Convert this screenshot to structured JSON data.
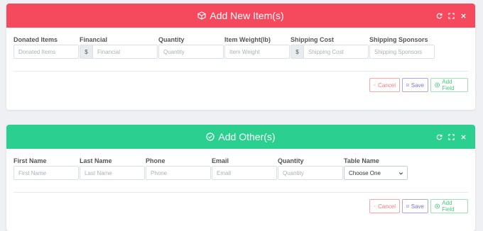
{
  "panel_items": {
    "title": "Add New Item(s)",
    "header_color": "#f5495e",
    "header_icon": "box-icon",
    "tools": [
      "refresh-icon",
      "expand-icon",
      "close-icon"
    ],
    "fields": [
      {
        "label": "Donated Items",
        "placeholder": "Donated Items"
      },
      {
        "label": "Financial",
        "addon": "$",
        "placeholder": "Financial"
      },
      {
        "label": "Quantity",
        "placeholder": "Quantity"
      },
      {
        "label": "Item Weight(lb)",
        "placeholder": "Item Weight"
      },
      {
        "label": "Shipping Cost",
        "addon": "$",
        "placeholder": "Shipping Cost"
      },
      {
        "label": "Shipping Sponsors",
        "placeholder": "Shipping Sponsors"
      }
    ],
    "buttons": {
      "cancel": "Cancel",
      "save": "Save",
      "add": "Add Field"
    }
  },
  "panel_others": {
    "title": "Add Other(s)",
    "header_color": "#2bcf8f",
    "header_icon": "check-circle-icon",
    "tools": [
      "refresh-icon",
      "expand-icon",
      "close-icon"
    ],
    "fields": [
      {
        "label": "First Name",
        "placeholder": "First Name"
      },
      {
        "label": "Last Name",
        "placeholder": "Last Name"
      },
      {
        "label": "Phone",
        "placeholder": "Phone"
      },
      {
        "label": "Email",
        "placeholder": "Email"
      },
      {
        "label": "Quantity",
        "placeholder": "Quantity"
      },
      {
        "label": "Table Name",
        "selected": "Choose One"
      }
    ],
    "buttons": {
      "cancel": "Cancel",
      "save": "Save",
      "add": "Add Field"
    }
  }
}
